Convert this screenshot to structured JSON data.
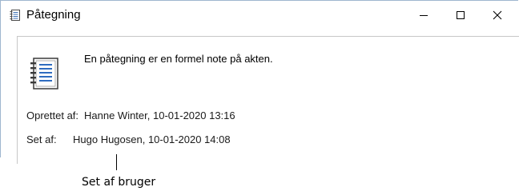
{
  "window": {
    "title": "Påtegning",
    "icon": "notebook-icon",
    "controls": {
      "minimize": "minimize-icon",
      "maximize": "maximize-icon",
      "close": "close-icon"
    }
  },
  "content": {
    "icon": "notebook-icon",
    "description": "En påtegning er en formel note på akten.",
    "created": {
      "label": "Oprettet af:",
      "value": "Hanne Winter, 10-01-2020 13:16"
    },
    "set": {
      "label": "Set af:",
      "value": "Hugo Hugosen, 10-01-2020 14:08"
    }
  },
  "annotation": {
    "label": "Set af bruger"
  }
}
